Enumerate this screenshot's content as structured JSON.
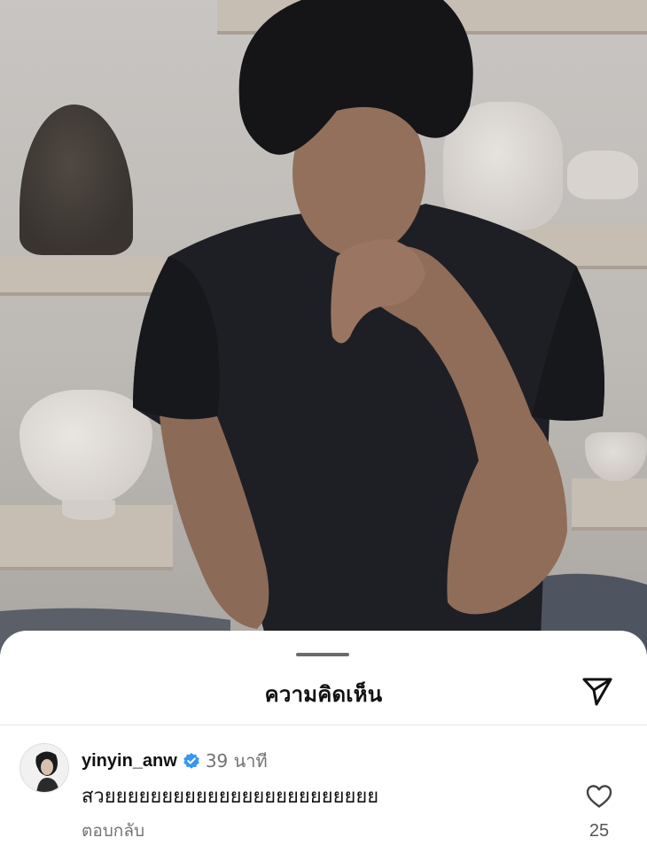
{
  "photo": {
    "subject": "man-in-black-tshirt-image"
  },
  "sheet": {
    "title": "ความคิดเห็น",
    "share_icon": "paper-plane-icon"
  },
  "comment": {
    "avatar_icon": "avatar-image",
    "username": "yinyin_anw",
    "verified_icon": "verified-badge-icon",
    "verified_color": "#3897f0",
    "timestamp": "39 นาที",
    "text": "สวยยยยยยยยยยยยยยยยยยยยยยยย",
    "reply_label": "ตอบกลับ",
    "like_icon": "heart-outline-icon",
    "like_count": "25"
  }
}
